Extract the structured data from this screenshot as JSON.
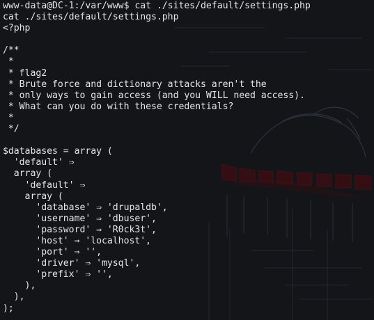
{
  "colors": {
    "background": "#141519",
    "text": "#e6e6e6",
    "wallpaper_accent": "#3a0d12"
  },
  "terminal": {
    "lines": [
      "www-data@DC-1:/var/www$ cat ./sites/default/settings.php",
      "cat ./sites/default/settings.php",
      "<?php",
      "",
      "/**",
      " *",
      " * flag2",
      " * Brute force and dictionary attacks aren't the",
      " * only ways to gain access (and you WILL need access).",
      " * What can you do with these credentials?",
      " *",
      " */",
      "",
      "$databases = array (",
      "  'default' ⇒",
      "  array (",
      "    'default' ⇒",
      "    array (",
      "      'database' ⇒ 'drupaldb',",
      "      'username' ⇒ 'dbuser',",
      "      'password' ⇒ 'R0ck3t',",
      "      'host' ⇒ 'localhost',",
      "      'port' ⇒ '',",
      "      'driver' ⇒ 'mysql',",
      "      'prefix' ⇒ '',",
      "    ),",
      "  ),",
      ");"
    ]
  }
}
